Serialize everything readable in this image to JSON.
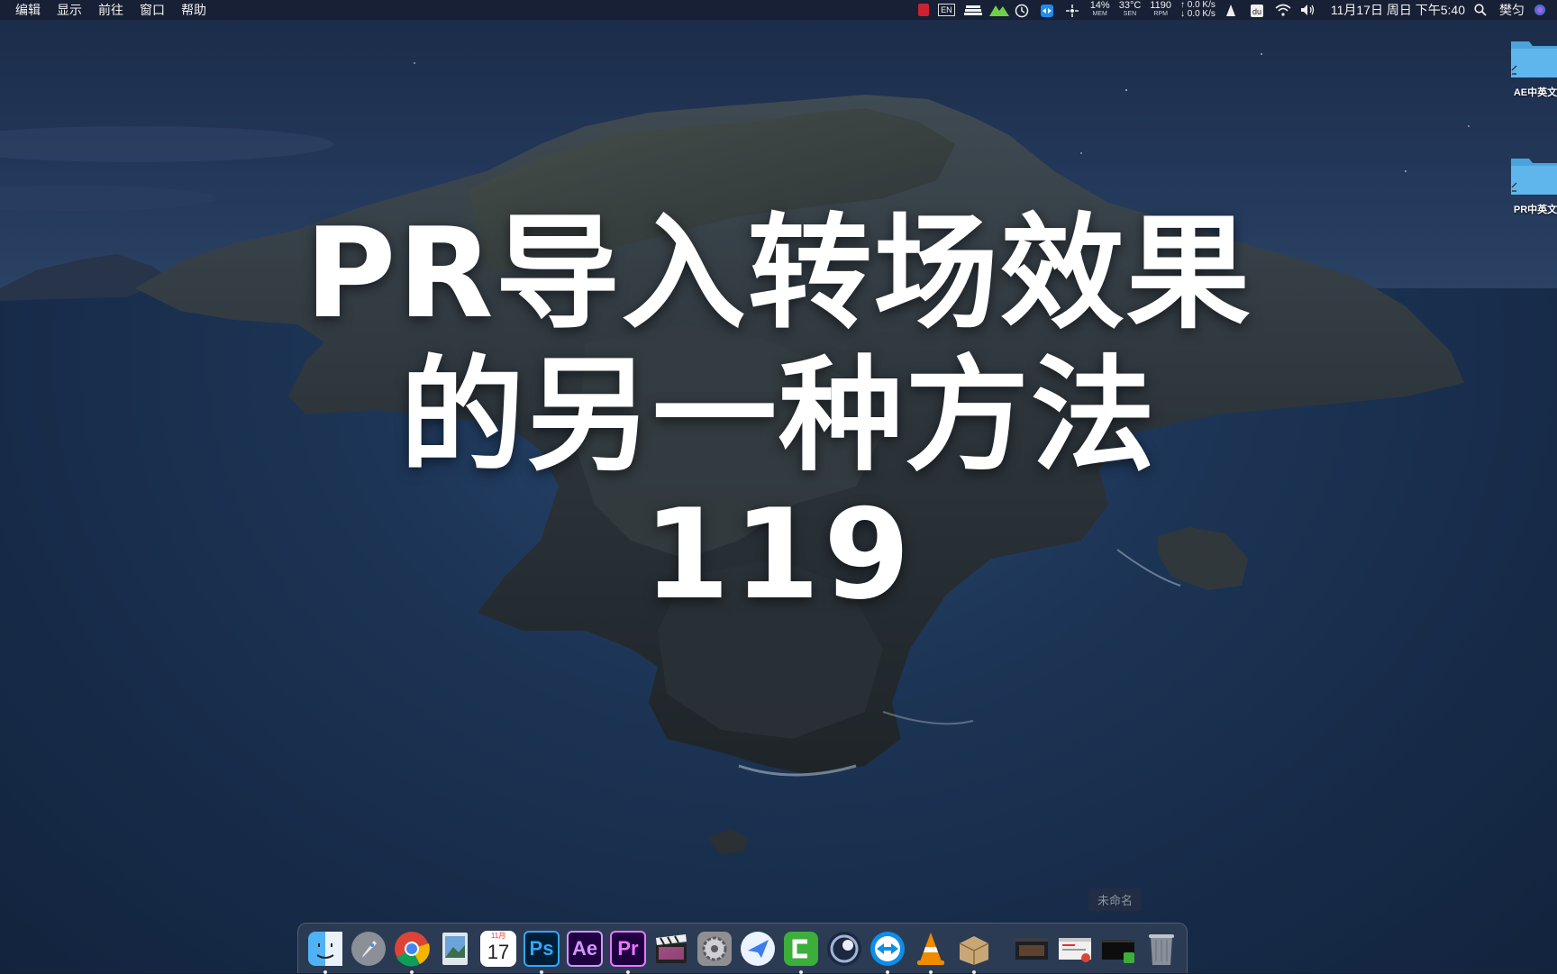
{
  "menubar": {
    "menus": [
      "编辑",
      "显示",
      "前往",
      "窗口",
      "帮助"
    ],
    "input_source": "EN",
    "mem": {
      "value": "14%",
      "unit": "MEM"
    },
    "temp": {
      "value": "33°C",
      "unit": "SEN"
    },
    "fan": {
      "value": "1190",
      "unit": "RPM"
    },
    "net_up": "↑ 0.0 K/s",
    "net_down": "↓ 0.0 K/s",
    "clock": "11月17日 周日 下午5:40",
    "user": "樊匀"
  },
  "desktop_icons": [
    {
      "label": "AE中英文"
    },
    {
      "label": "PR中英文"
    }
  ],
  "title_overlay": {
    "line1": "PR导入转场效果",
    "line2": "的另一种方法",
    "line3": "119"
  },
  "untitled_label": "未命名",
  "dock": {
    "calendar_month": "11月",
    "calendar_day": "17",
    "ps": "Ps",
    "ae": "Ae",
    "pr": "Pr"
  },
  "colors": {
    "menubar_bg": "#161e2e",
    "accent_ps": "#31a8ff",
    "accent_ae": "#cf96fd",
    "accent_pr": "#ea77ff"
  }
}
